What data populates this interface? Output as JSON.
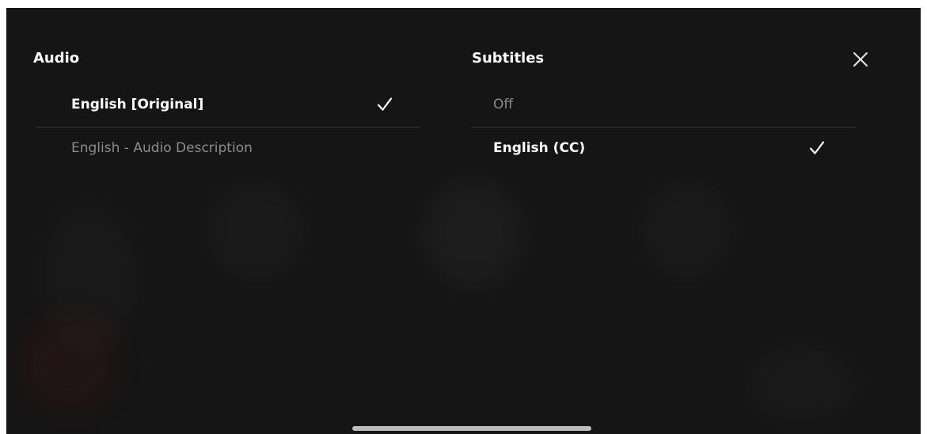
{
  "audio": {
    "title": "Audio",
    "options": [
      {
        "label": "English [Original]",
        "selected": true
      },
      {
        "label": "English - Audio Description",
        "selected": false
      }
    ]
  },
  "subtitles": {
    "title": "Subtitles",
    "options": [
      {
        "label": "Off",
        "selected": false
      },
      {
        "label": "English (CC)",
        "selected": true
      }
    ]
  },
  "icons": {
    "close": "close-icon",
    "selected_marker": "checkmark-icon"
  },
  "colors": {
    "background": "#151515",
    "selected_text": "#ffffff",
    "unselected_text": "#8c8c8c",
    "divider": "#343434"
  }
}
